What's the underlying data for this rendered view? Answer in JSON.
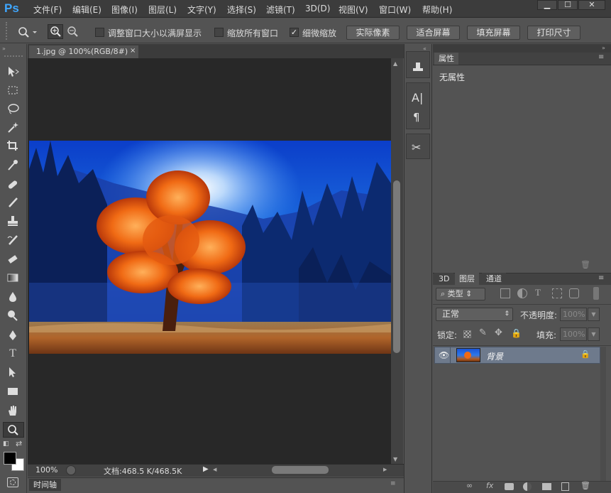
{
  "app": {
    "logo": "Ps"
  },
  "menu": [
    "文件(F)",
    "编辑(E)",
    "图像(I)",
    "图层(L)",
    "文字(Y)",
    "选择(S)",
    "滤镜(T)",
    "3D(D)",
    "视图(V)",
    "窗口(W)",
    "帮助(H)"
  ],
  "options": {
    "resize_windows": "调整窗口大小以满屏显示",
    "zoom_all": "缩放所有窗口",
    "scrubby_zoom": "细微缩放",
    "actual_pixels": "实际像素",
    "fit_screen": "适合屏幕",
    "fill_screen": "填充屏幕",
    "print_size": "打印尺寸",
    "scrubby_checked": true
  },
  "document": {
    "tab_title": "1.jpg @ 100%(RGB/8#)",
    "zoom": "100%",
    "doc_size": "文档:468.5 K/468.5K"
  },
  "properties": {
    "tab": "属性",
    "empty": "无属性"
  },
  "layers_panel": {
    "tabs": [
      "3D",
      "图层",
      "通道"
    ],
    "filter_kind": "类型",
    "blend_mode": "正常",
    "opacity_label": "不透明度:",
    "opacity_value": "100%",
    "lock_label": "锁定:",
    "fill_label": "填充:",
    "fill_value": "100%",
    "layers": [
      {
        "name": "背景",
        "locked": true,
        "visible": true
      }
    ]
  },
  "timeline": {
    "tab": "时间轴"
  },
  "colors": {
    "accent": "#3fa7ff",
    "canvas_bg": "#282828",
    "panel_bg": "#535353"
  }
}
